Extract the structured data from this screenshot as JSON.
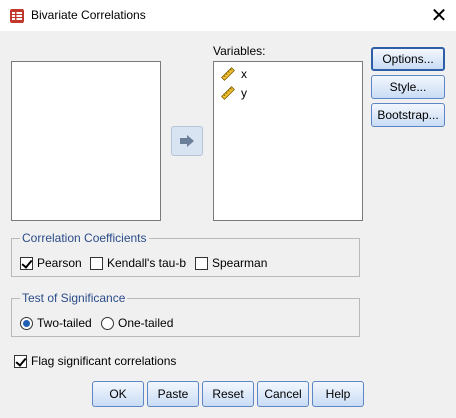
{
  "window": {
    "title": "Bivariate Correlations",
    "close_glyph": "✕"
  },
  "target_list": {
    "label": "Variables:",
    "items": [
      {
        "name": "x",
        "icon": "scale-ruler-icon"
      },
      {
        "name": "y",
        "icon": "scale-ruler-icon"
      }
    ]
  },
  "side_buttons": {
    "options": "Options...",
    "style": "Style...",
    "bootstrap": "Bootstrap..."
  },
  "correlation_coefficients": {
    "legend": "Correlation Coefficients",
    "pearson": {
      "label": "Pearson",
      "checked": true
    },
    "kendall": {
      "label": "Kendall's tau-b",
      "checked": false
    },
    "spearman": {
      "label": "Spearman",
      "checked": false
    }
  },
  "test_of_significance": {
    "legend": "Test of Significance",
    "two_tailed": {
      "label": "Two-tailed",
      "selected": true
    },
    "one_tailed": {
      "label": "One-tailed",
      "selected": false
    }
  },
  "flag_significant": {
    "label": "Flag significant correlations",
    "checked": true
  },
  "bottom_buttons": {
    "ok": "OK",
    "paste": "Paste",
    "reset": "Reset",
    "cancel": "Cancel",
    "help": "Help"
  },
  "colors": {
    "group_legend": "#2b4c8a",
    "button_border": "#5c86c5",
    "radio_dot": "#1f5fb5"
  }
}
